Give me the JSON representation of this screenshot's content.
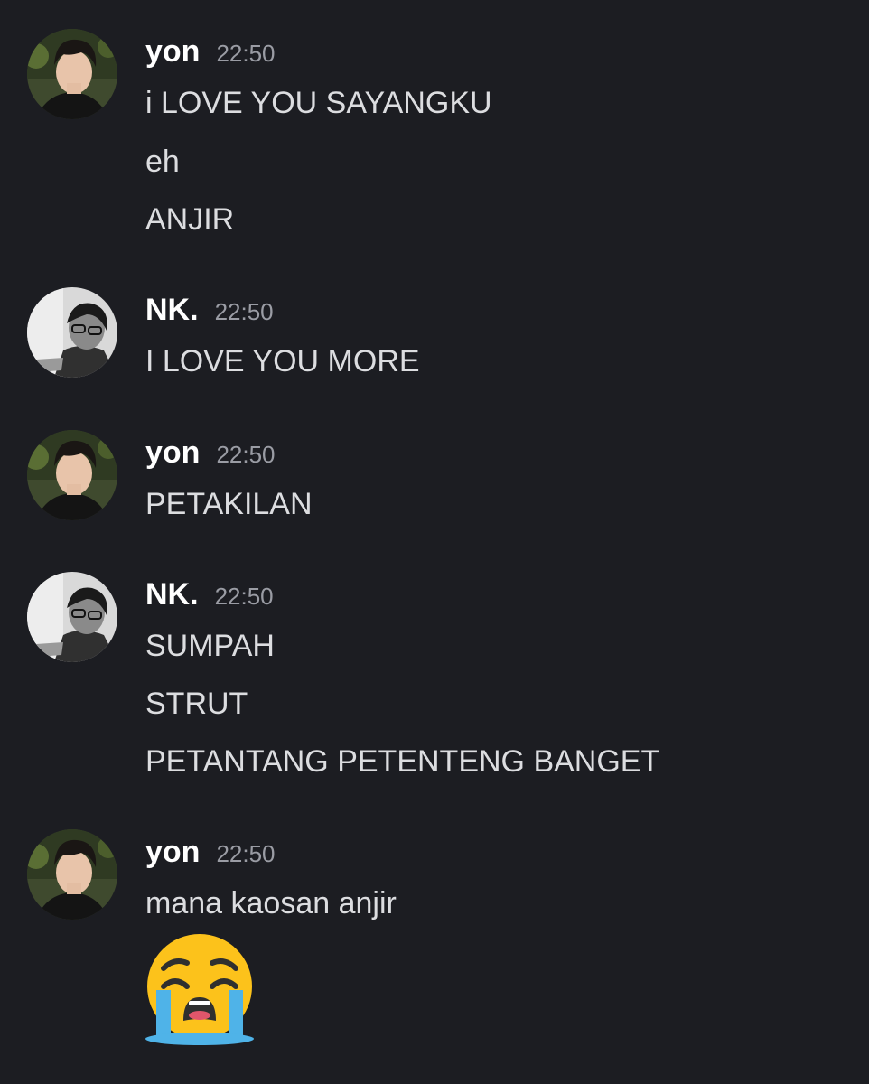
{
  "messages": [
    {
      "author": "yon",
      "time": "22:50",
      "avatar_icon": "yon-avatar-icon",
      "lines": [
        "i LOVE YOU SAYANGKU",
        "eh",
        "ANJIR"
      ]
    },
    {
      "author": "NK.",
      "time": "22:50",
      "avatar_icon": "nk-avatar-icon",
      "lines": [
        "I LOVE YOU MORE"
      ]
    },
    {
      "author": "yon",
      "time": "22:50",
      "avatar_icon": "yon-avatar-icon",
      "lines": [
        "PETAKILAN"
      ]
    },
    {
      "author": "NK.",
      "time": "22:50",
      "avatar_icon": "nk-avatar-icon",
      "lines": [
        "SUMPAH",
        "STRUT",
        "PETANTANG PETENTENG BANGET"
      ]
    },
    {
      "author": "yon",
      "time": "22:50",
      "avatar_icon": "yon-avatar-icon",
      "lines": [
        "mana kaosan anjir"
      ],
      "emoji": "loudly-crying-face-emoji"
    }
  ],
  "colors": {
    "background": "#1c1d22",
    "username": "#ffffff",
    "timestamp": "#9a9ca4",
    "message_text": "#dcdde0",
    "emoji_face": "#fcc21b",
    "emoji_tears": "#4fb3e8"
  }
}
